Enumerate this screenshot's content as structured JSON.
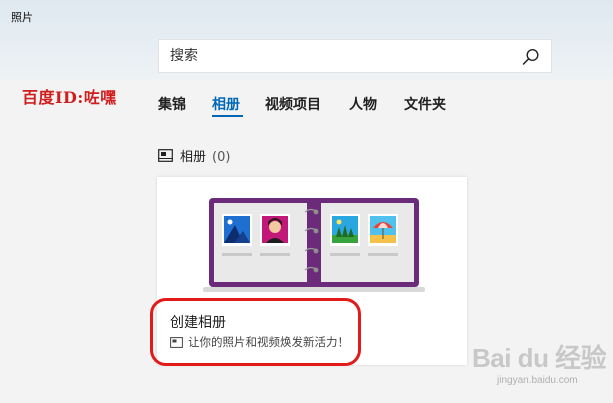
{
  "app": {
    "title": "照片"
  },
  "search": {
    "placeholder": "搜索",
    "value": "",
    "icon": "search-icon"
  },
  "watermark": {
    "left_text": "百度ID:咗嘿",
    "logo_text": "Bai du 经验",
    "url": "jingyan.baidu.com"
  },
  "nav": {
    "tabs": [
      {
        "label": "集锦",
        "active": false
      },
      {
        "label": "相册",
        "active": true
      },
      {
        "label": "视频项目",
        "active": false
      },
      {
        "label": "人物",
        "active": false
      },
      {
        "label": "文件夹",
        "active": false
      }
    ]
  },
  "section": {
    "title": "相册",
    "count": "(0)",
    "icon": "album-icon"
  },
  "card": {
    "title": "创建相册",
    "subtitle": "让你的照片和视频焕发新活力！",
    "subtitle_icon": "album-icon",
    "illustration": "photo-album-illustration"
  },
  "colors": {
    "accent": "#0067b8",
    "album_purple": "#6b2a7a",
    "highlight_red": "#e21a1a",
    "watermark_red": "#d01e1e"
  }
}
